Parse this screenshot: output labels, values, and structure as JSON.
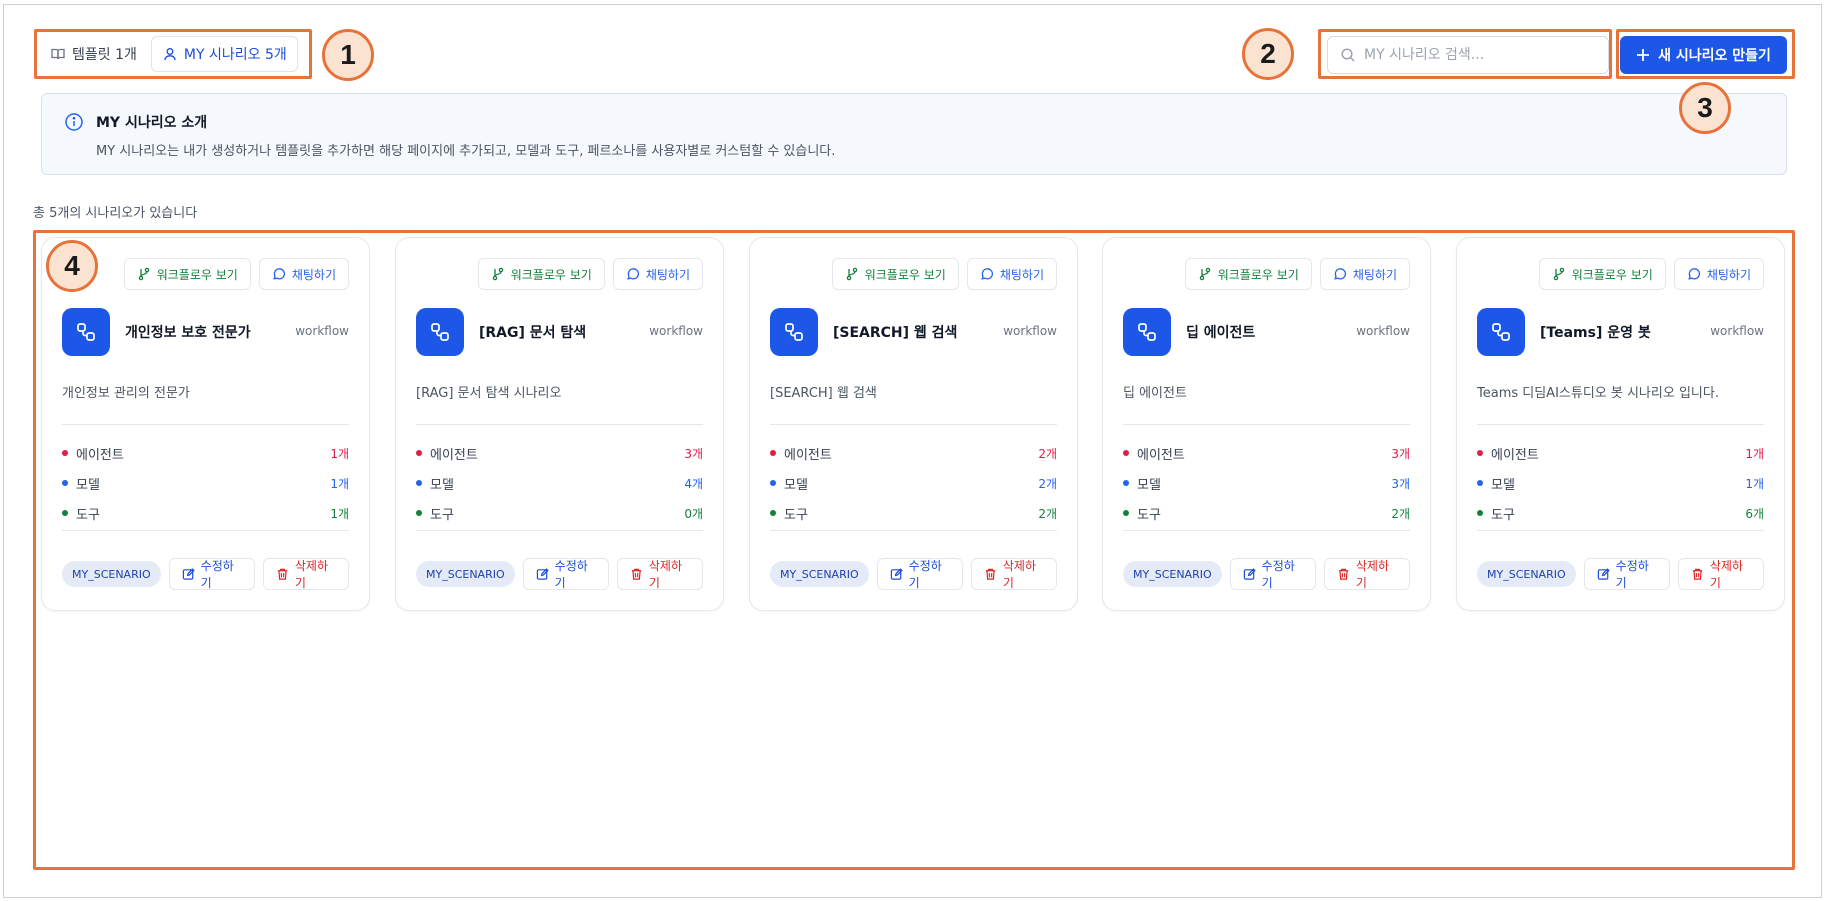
{
  "tabs": [
    {
      "label": "템플릿 1개",
      "icon": "book-icon",
      "active": false
    },
    {
      "label": "MY 시나리오 5개",
      "icon": "user-icon",
      "active": true
    }
  ],
  "search": {
    "placeholder": "MY 시나리오 검색..."
  },
  "new_button": {
    "label": "새 시나리오 만들기",
    "icon": "plus-icon"
  },
  "info": {
    "title": "MY 시나리오 소개",
    "description": "MY 시나리오는 내가 생성하거나 템플릿을 추가하면 해당 페이지에 추가되고, 모델과 도구, 페르소나를 사용자별로 커스텀할 수 있습니다."
  },
  "count_text": "총 5개의 시나리오가 있습니다",
  "annotations": [
    "1",
    "2",
    "3",
    "4"
  ],
  "card_labels": {
    "workflow_button": "워크플로우 보기",
    "chat_button": "채팅하기",
    "edit_button": "수정하기",
    "delete_button": "삭제하기",
    "agents": "에이전트",
    "models": "모델",
    "tools": "도구",
    "tag": "MY_SCENARIO",
    "type": "workflow"
  },
  "cards": [
    {
      "name": "개인정보 보호 전문가",
      "description": "개인정보 관리의 전문가",
      "agents": "1개",
      "models": "1개",
      "tools": "1개"
    },
    {
      "name": "[RAG] 문서 탐색",
      "description": "[RAG] 문서 탐색 시나리오",
      "agents": "3개",
      "models": "4개",
      "tools": "0개"
    },
    {
      "name": "[SEARCH] 웹 검색",
      "description": "[SEARCH] 웹 검색",
      "agents": "2개",
      "models": "2개",
      "tools": "2개"
    },
    {
      "name": "딥 에이전트",
      "description": "딥 에이전트",
      "agents": "3개",
      "models": "3개",
      "tools": "2개"
    },
    {
      "name": "[Teams] 운영 봇",
      "description": "Teams 디딤AI스튜디오 봇 시나리오 입니다.",
      "agents": "1개",
      "models": "1개",
      "tools": "6개"
    }
  ],
  "colors": {
    "accent": "#1d57e8",
    "agents": "#e11d48",
    "models": "#2563eb",
    "tools": "#15803d",
    "annotation": "#e8733a"
  }
}
